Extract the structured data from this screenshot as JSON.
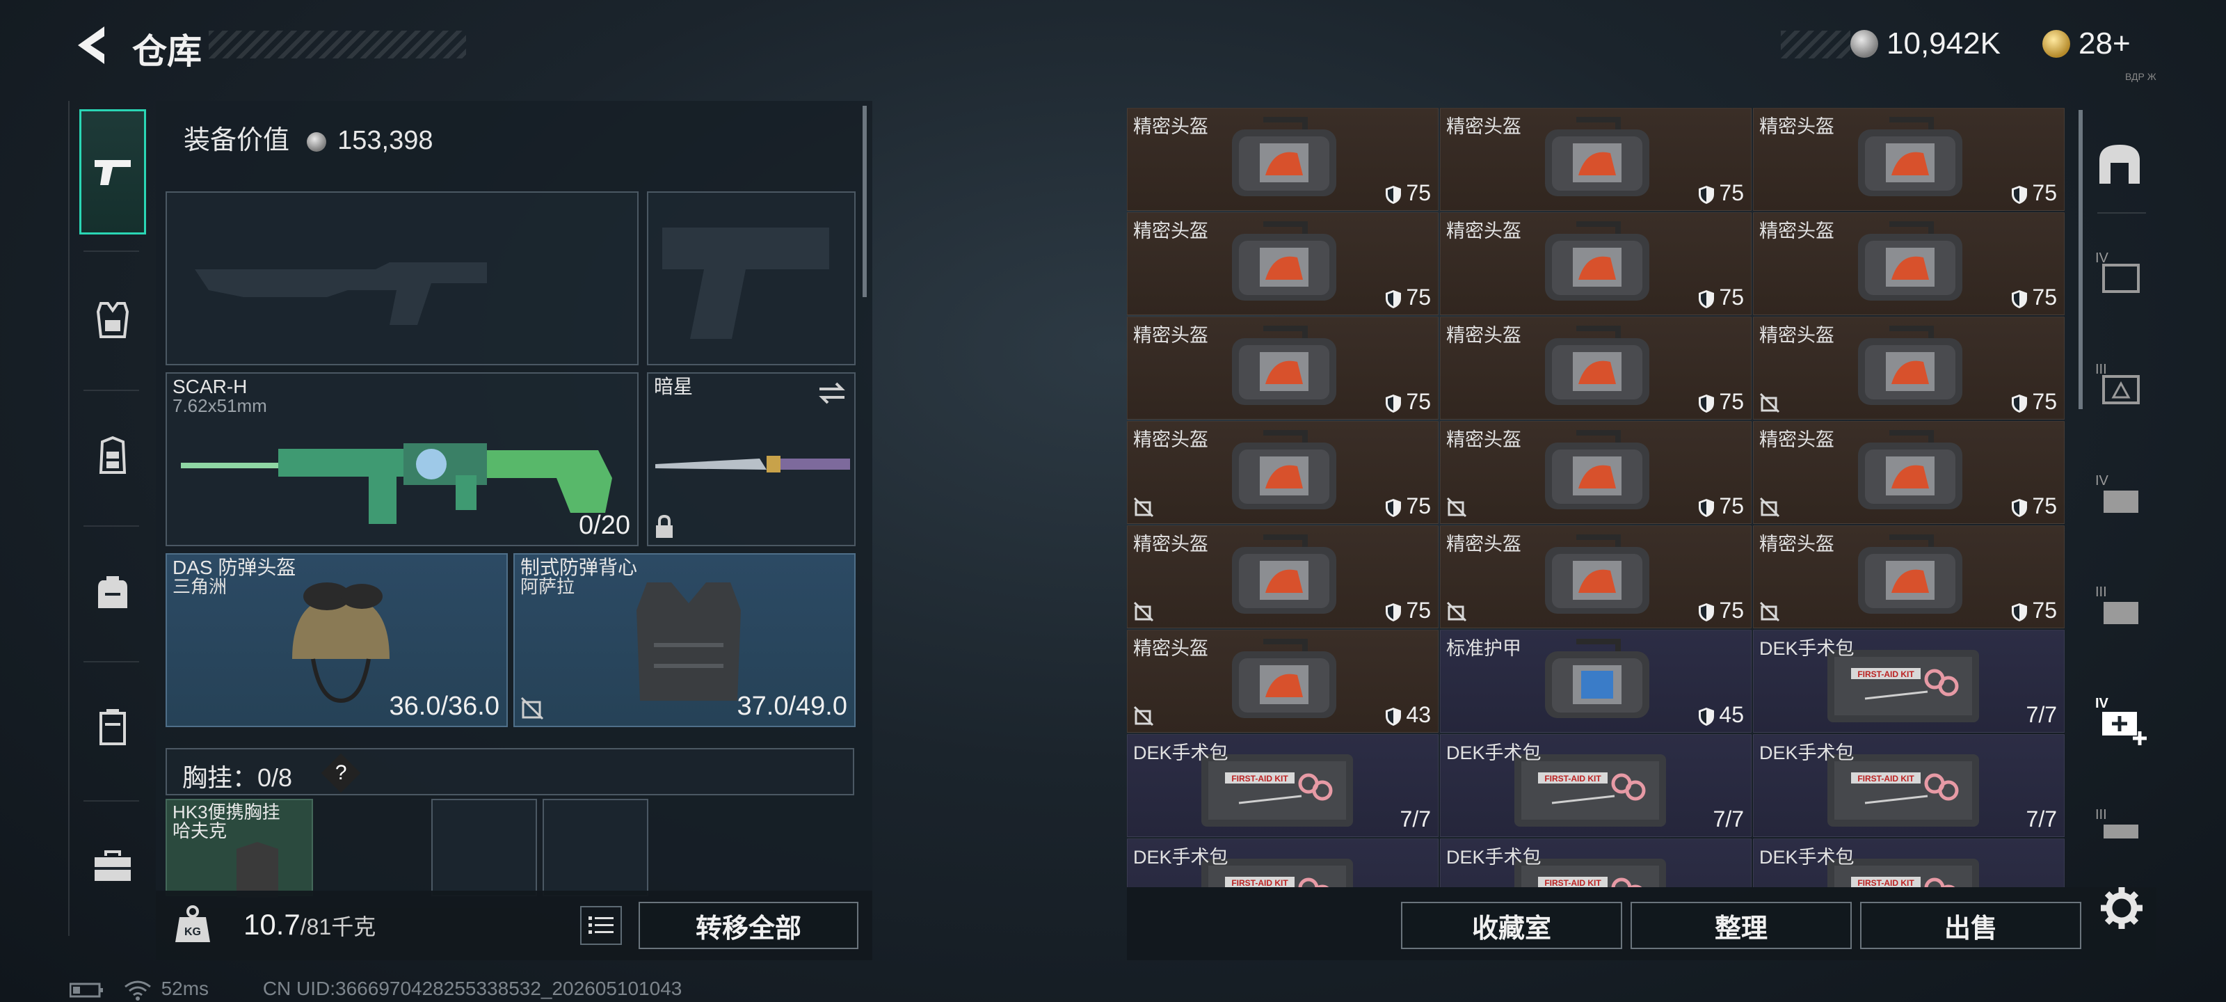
{
  "header": {
    "title": "仓库",
    "currency": [
      {
        "icon": "silver-coin-icon",
        "value": "10,942K"
      },
      {
        "icon": "gold-coin-icon",
        "value": "28+"
      }
    ],
    "version_tag": "ВДР Ж"
  },
  "left_nav": [
    {
      "name": "firearms",
      "icon": "pistol-icon",
      "active": true
    },
    {
      "name": "armor",
      "icon": "vest-icon"
    },
    {
      "name": "rig",
      "icon": "rig-icon"
    },
    {
      "name": "backpack",
      "icon": "backpack-icon"
    },
    {
      "name": "container",
      "icon": "container-icon"
    },
    {
      "name": "toolbox",
      "icon": "toolbox-icon"
    }
  ],
  "loadout": {
    "equip_value_label": "装备价值",
    "equip_value": "153,398",
    "primary_weapon": {
      "name": "SCAR-H",
      "caliber": "7.62x51mm",
      "ammo": "0/20"
    },
    "melee": {
      "name": "暗星"
    },
    "helmet": {
      "name": "DAS 防弹头盔",
      "faction": "三角洲",
      "durability": "36.0/36.0"
    },
    "armor": {
      "name": "制式防弹背心",
      "faction": "阿萨拉",
      "durability": "37.0/49.0"
    },
    "chest_rig": {
      "label": "胸挂：",
      "value": "0/8",
      "help": "?"
    },
    "chest_item": {
      "name": "HK3便携胸挂",
      "faction": "哈夫克"
    },
    "weight": "10.7",
    "weight_max": "/81千克",
    "transfer_all": "转移全部"
  },
  "inventory": {
    "rows": [
      [
        {
          "name": "精密头盔",
          "value": "75",
          "type": "helmet-bag",
          "nosale": false
        },
        {
          "name": "精密头盔",
          "value": "75",
          "type": "helmet-bag",
          "nosale": false
        },
        {
          "name": "精密头盔",
          "value": "75",
          "type": "helmet-bag",
          "nosale": false
        }
      ],
      [
        {
          "name": "精密头盔",
          "value": "75",
          "type": "helmet-bag",
          "nosale": false
        },
        {
          "name": "精密头盔",
          "value": "75",
          "type": "helmet-bag",
          "nosale": false
        },
        {
          "name": "精密头盔",
          "value": "75",
          "type": "helmet-bag",
          "nosale": false
        }
      ],
      [
        {
          "name": "精密头盔",
          "value": "75",
          "type": "helmet-bag",
          "nosale": false
        },
        {
          "name": "精密头盔",
          "value": "75",
          "type": "helmet-bag",
          "nosale": false
        },
        {
          "name": "精密头盔",
          "value": "75",
          "type": "helmet-bag",
          "nosale": true
        }
      ],
      [
        {
          "name": "精密头盔",
          "value": "75",
          "type": "helmet-bag",
          "nosale": true
        },
        {
          "name": "精密头盔",
          "value": "75",
          "type": "helmet-bag",
          "nosale": true
        },
        {
          "name": "精密头盔",
          "value": "75",
          "type": "helmet-bag",
          "nosale": true
        }
      ],
      [
        {
          "name": "精密头盔",
          "value": "75",
          "type": "helmet-bag",
          "nosale": true
        },
        {
          "name": "精密头盔",
          "value": "75",
          "type": "helmet-bag",
          "nosale": true
        },
        {
          "name": "精密头盔",
          "value": "75",
          "type": "helmet-bag",
          "nosale": true
        }
      ],
      [
        {
          "name": "精密头盔",
          "value": "43",
          "type": "helmet-bag",
          "nosale": true
        },
        {
          "name": "标准护甲",
          "value": "45",
          "type": "armor-bag",
          "nosale": false
        },
        {
          "name": "DEK手术包",
          "value": "7/7",
          "type": "medkit",
          "nosale": false
        }
      ],
      [
        {
          "name": "DEK手术包",
          "value": "7/7",
          "type": "medkit",
          "nosale": false
        },
        {
          "name": "DEK手术包",
          "value": "7/7",
          "type": "medkit",
          "nosale": false
        },
        {
          "name": "DEK手术包",
          "value": "7/7",
          "type": "medkit",
          "nosale": false
        }
      ],
      [
        {
          "name": "DEK手术包",
          "value": "",
          "type": "medkit",
          "nosale": false
        },
        {
          "name": "DEK手术包",
          "value": "",
          "type": "medkit",
          "nosale": false
        },
        {
          "name": "DEK手术包",
          "value": "",
          "type": "medkit",
          "nosale": false
        }
      ]
    ],
    "medkit_label": "FIRST-AID KIT"
  },
  "footer_buttons": {
    "collection": "收藏室",
    "sort": "整理",
    "sell": "出售"
  },
  "right_tabs": [
    "home-icon",
    "storage-iv-icon",
    "storage-iii-icon",
    "storage-iv-b-icon",
    "storage-iii-b-icon",
    "add-storage-icon",
    "storage-iii-c-icon"
  ],
  "right_tab_labels": {
    "iv": "IV",
    "iii": "III"
  },
  "status": {
    "ping": "52ms",
    "uid": "CN UID:3666970428255338532_202605101043"
  },
  "colors": {
    "accent": "#2ad6b4",
    "brown_cell": "#3a2e27",
    "purple_cell": "#2c2d45",
    "blue_slot": "#2c4a64"
  }
}
